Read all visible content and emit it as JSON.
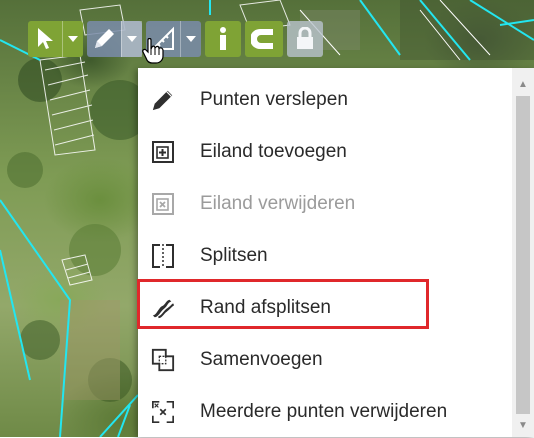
{
  "toolbar": {
    "buttons": [
      {
        "name": "select-tool",
        "icon": "cursor-arrow-icon",
        "color": "#7fa335",
        "has_dropdown": true
      },
      {
        "name": "edit-tool",
        "icon": "pencil-icon",
        "color": "#7a8caa",
        "has_dropdown": true,
        "dropdown_open": true
      },
      {
        "name": "measure-tool",
        "icon": "ruler-icon",
        "color": "#7a8caa",
        "has_dropdown": true
      },
      {
        "name": "info-tool",
        "icon": "info-icon",
        "color": "#7fa335"
      },
      {
        "name": "snap-tool",
        "icon": "magnet-icon",
        "color": "#7fa335"
      },
      {
        "name": "lock-tool",
        "icon": "lock-icon",
        "color": "#b9c3cd"
      }
    ]
  },
  "menu": {
    "items": [
      {
        "label": "Punten verslepen",
        "icon": "pencil-icon",
        "enabled": true
      },
      {
        "label": "Eiland toevoegen",
        "icon": "add-island-icon",
        "enabled": true
      },
      {
        "label": "Eiland verwijderen",
        "icon": "remove-island-icon",
        "enabled": false
      },
      {
        "label": "Splitsen",
        "icon": "split-icon",
        "enabled": true
      },
      {
        "label": "Rand afsplitsen",
        "icon": "split-edge-icon",
        "enabled": true,
        "highlighted": true
      },
      {
        "label": "Samenvoegen",
        "icon": "merge-icon",
        "enabled": true
      },
      {
        "label": "Meerdere punten verwijderen",
        "icon": "delete-multiple-points-icon",
        "enabled": true
      }
    ],
    "highlight_color": "#e0282b"
  },
  "colors": {
    "parcel_outline": "#23e6f0",
    "green_button": "#7fa335",
    "slate_button": "#7a8caa"
  }
}
